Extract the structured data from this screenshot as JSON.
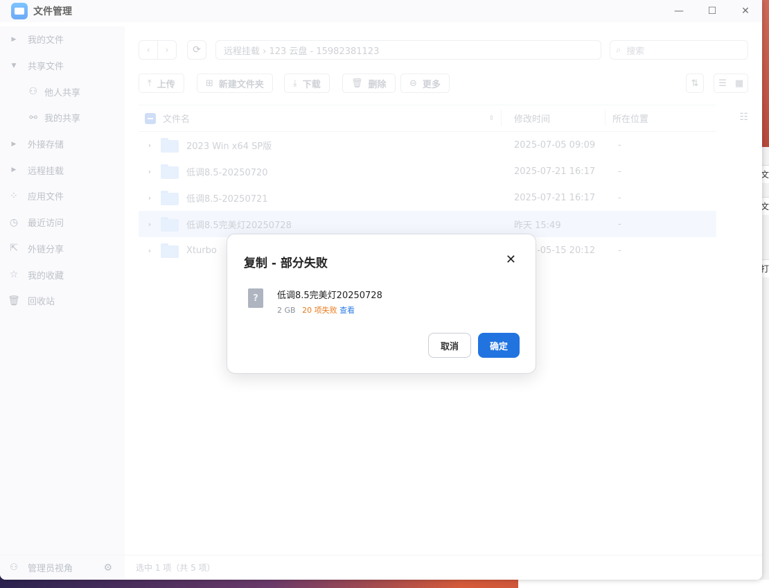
{
  "window": {
    "title": "文件管理",
    "minimize": "—",
    "maximize": "☐",
    "close": "✕"
  },
  "sidebar": {
    "items": [
      {
        "label": "我的文件",
        "icon": "caret-right-icon"
      },
      {
        "label": "共享文件",
        "icon": "caret-down-icon"
      },
      {
        "label": "他人共享",
        "icon": "users-icon"
      },
      {
        "label": "我的共享",
        "icon": "share-icon"
      },
      {
        "label": "外接存储",
        "icon": "caret-right-icon"
      },
      {
        "label": "远程挂载",
        "icon": "caret-right-icon"
      },
      {
        "label": "应用文件",
        "icon": "apps-icon"
      },
      {
        "label": "最近访问",
        "icon": "clock-icon"
      },
      {
        "label": "外链分享",
        "icon": "external-link-icon"
      },
      {
        "label": "我的收藏",
        "icon": "star-icon"
      },
      {
        "label": "回收站",
        "icon": "trash-icon"
      }
    ],
    "admin_view": "管理员视角"
  },
  "toprow": {
    "path": "远程挂载 › 123 云盘 - 15982381123",
    "search_placeholder": "搜索"
  },
  "toolbar": {
    "upload": "上传",
    "new_folder": "新建文件夹",
    "download": "下载",
    "delete": "删除",
    "more": "更多"
  },
  "table": {
    "headers": {
      "name": "文件名",
      "modified": "修改时间",
      "location": "所在位置"
    },
    "rows": [
      {
        "name": "2023 Win x64 SP版",
        "modified": "2025-07-05 09:09",
        "location": "-"
      },
      {
        "name": "低调8.5-20250720",
        "modified": "2025-07-21 16:17",
        "location": "-"
      },
      {
        "name": "低调8.5-20250721",
        "modified": "2025-07-21 16:17",
        "location": "-"
      },
      {
        "name": "低调8.5完美灯20250728",
        "modified": "昨天 15:49",
        "location": "-"
      },
      {
        "name": "Xturbo",
        "modified": "2025-05-15 20:12",
        "location": "-"
      }
    ]
  },
  "status": {
    "text": "选中 1 项（共 5 项）"
  },
  "dialog": {
    "title": "复制 - 部分失败",
    "file_name": "低调8.5完美灯20250728",
    "file_size": "2 GB",
    "fail_text": "20 项失败",
    "view_link": "查看",
    "cancel": "取消",
    "ok": "确定"
  },
  "colors": {
    "accent": "#2173e0",
    "warning": "#e67a1c",
    "link": "#2e7ce6"
  }
}
